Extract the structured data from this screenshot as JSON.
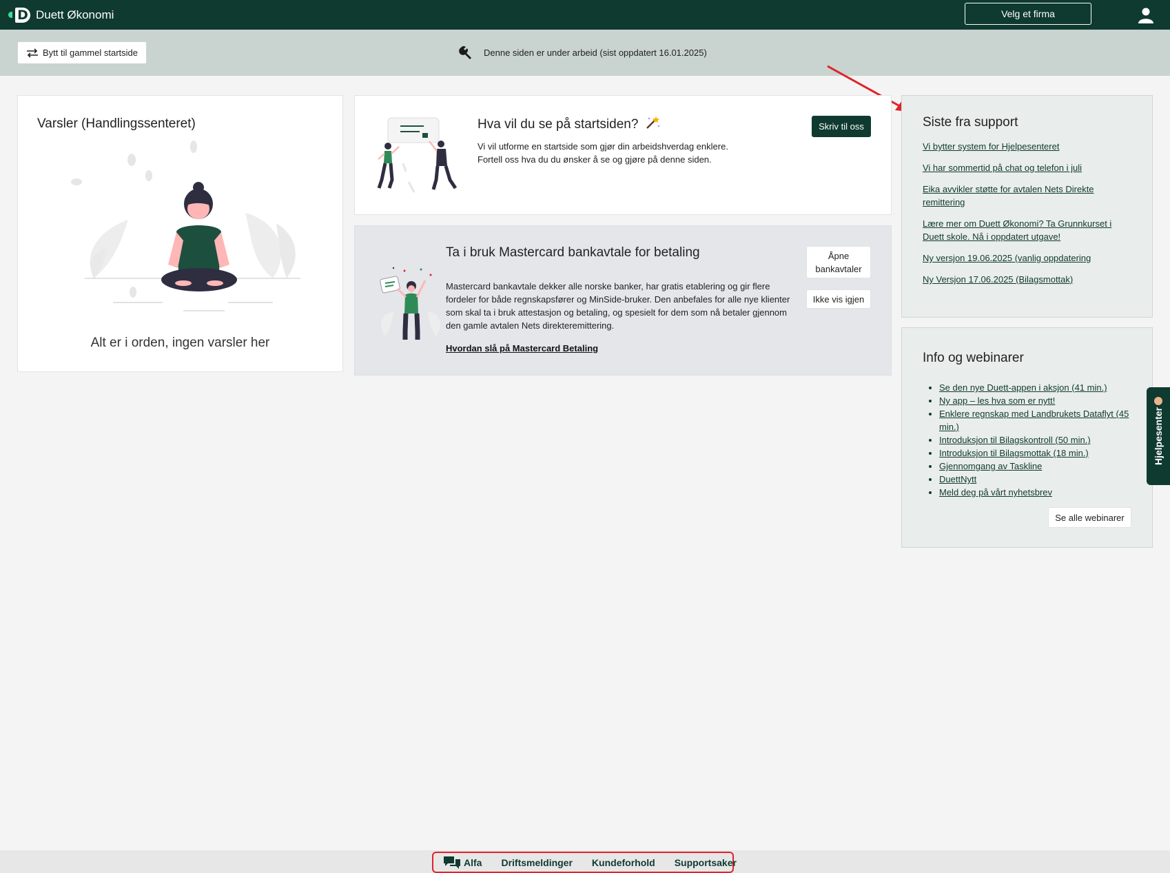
{
  "topbar": {
    "app_title": "Duett Økonomi",
    "logo_letter": "D",
    "velg_firma": "Velg et firma",
    "user_icon": "user-icon"
  },
  "banner": {
    "switch_button": "Bytt til gammel startside",
    "message": "Denne siden er under arbeid (sist oppdatert 16.01.2025)"
  },
  "varsler": {
    "title": "Varsler (Handlingssenteret)",
    "empty_text": "Alt er i orden, ingen varsler her"
  },
  "hva": {
    "title": "Hva vil du se på startsiden?",
    "title_icon": "magic-wand-icon",
    "text_line1": "Vi vil utforme en startside som gjør din arbeidshverdag enklere.",
    "text_line2": "Fortell oss hva du du ønsker å se og gjøre på denne siden.",
    "button": "Skriv til oss"
  },
  "mastercard": {
    "title": "Ta i bruk Mastercard bankavtale for betaling",
    "text": "Mastercard bankavtale dekker alle norske banker, har gratis etablering og gir flere fordeler for både regnskapsfører og MinSide-bruker. Den anbefales for alle nye klienter som skal ta i bruk attestasjon og betaling, og spesielt for dem som nå betaler gjennom den gamle avtalen Nets direkteremittering.",
    "link": "Hvordan slå på Mastercard Betaling",
    "open_button_line1": "Åpne",
    "open_button_line2": "bankavtaler",
    "dismiss_button": "Ikke vis igjen"
  },
  "support": {
    "title": "Siste fra support",
    "links": [
      "Vi bytter system for Hjelpesenteret",
      "Vi har sommertid på chat og telefon i juli",
      "Eika avvikler støtte for avtalen Nets Direkte remittering",
      "Lære mer om Duett Økonomi? Ta Grunnkurset i Duett skole. Nå i oppdatert utgave!",
      "Ny versjon 19.06.2025 (vanlig oppdatering",
      "Ny Versjon 17.06.2025 (Bilagsmottak)"
    ]
  },
  "info": {
    "title": "Info og webinarer",
    "items": [
      "Se den nye Duett-appen i aksjon (41 min.)",
      "Ny app – les hva som er nytt!",
      "Enklere regnskap med Landbrukets Dataflyt (45 min.)",
      "Introduksjon til Bilagskontroll (50 min.)",
      "Introduksjon til Bilagsmottak (18 min.)",
      "Gjennomgang av Taskline",
      "DuettNytt",
      "Meld deg på vårt nyhetsbrev"
    ],
    "button": "Se alle webinarer"
  },
  "help_tab": {
    "label": "Hjelpesenter"
  },
  "bottom_nav": {
    "items": [
      "Alfa",
      "Driftsmeldinger",
      "Kundeforhold",
      "Supportsaker"
    ]
  },
  "colors": {
    "brand_dark_green": "#0f3a2f",
    "accent_green": "#3ddc97",
    "annotation_red": "#e0222a"
  }
}
